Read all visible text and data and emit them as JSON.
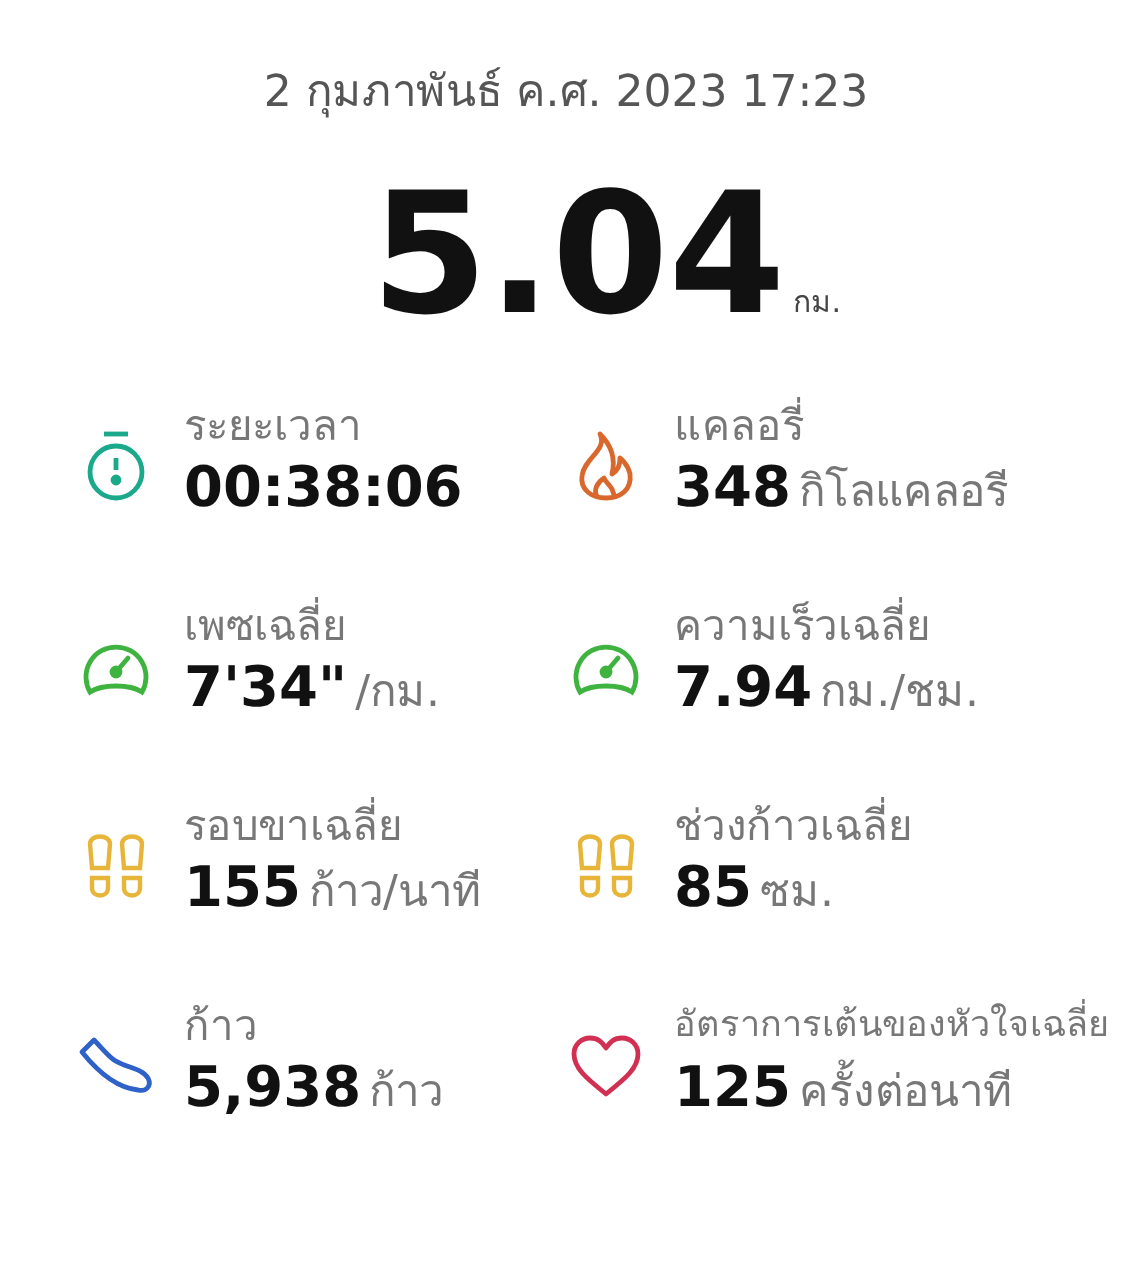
{
  "date": "2 กุมภาพันธ์ ค.ศ. 2023 17:23",
  "distance": {
    "value": "5.04",
    "unit": "กม."
  },
  "stats": [
    {
      "kind": "stopwatch",
      "color": "#1aa98a",
      "label": "ระยะเวลา",
      "value": "00:38:06"
    },
    {
      "kind": "flame",
      "color": "#d8682c",
      "label": "แคลอรี่",
      "value": "348",
      "unit": "กิโลแคลอรี"
    },
    {
      "kind": "gauge",
      "color": "#3fb33f",
      "label": "เพซเฉลี่ย",
      "value": "7'34\"",
      "unit": "/กม."
    },
    {
      "kind": "gauge",
      "color": "#3fb33f",
      "label": "ความเร็วเฉลี่ย",
      "value": "7.94",
      "unit": "กม./ชม."
    },
    {
      "kind": "footprints",
      "color": "#e6b53a",
      "label": "รอบขาเฉลี่ย",
      "value": "155",
      "unit": "ก้าว/นาที"
    },
    {
      "kind": "footprints",
      "color": "#e6b53a",
      "label": "ช่วงก้าวเฉลี่ย",
      "value": "85",
      "unit": "ซม."
    },
    {
      "kind": "shoe",
      "color": "#2f62c8",
      "label": "ก้าว",
      "value": "5,938",
      "unit": "ก้าว"
    },
    {
      "kind": "heart",
      "color": "#d23052",
      "label": "อัตราการเต้นของหัวใจเฉลี่ย",
      "value": "125",
      "unit": "ครั้งต่อนาที"
    }
  ]
}
